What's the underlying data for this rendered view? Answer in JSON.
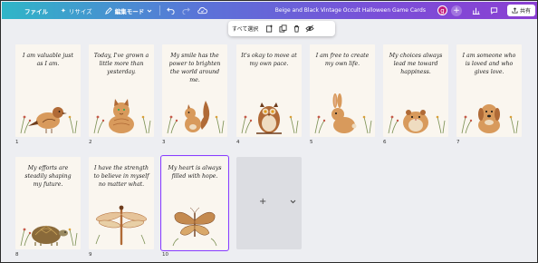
{
  "toolbar": {
    "file_label": "ファイル",
    "resize_label": "リサイズ",
    "mode_label": "編集モード",
    "doc_title": "Beige and Black Vintage Occult Halloween Game Cards",
    "avatar_letter": "g",
    "share_label": "共有"
  },
  "selection_toolbar": {
    "select_all_label": "すべて選択"
  },
  "pages": [
    {
      "number": "1",
      "quote": "I am valuable just as I am.",
      "animal": "bird"
    },
    {
      "number": "2",
      "quote": "Today, I've grown a little more than yesterday.",
      "animal": "cat"
    },
    {
      "number": "3",
      "quote": "My smile has the power to brighten the world around me.",
      "animal": "squirrel"
    },
    {
      "number": "4",
      "quote": "It's okay to move at my own pace.",
      "animal": "owl"
    },
    {
      "number": "5",
      "quote": "I am free to create my own life.",
      "animal": "rabbit"
    },
    {
      "number": "6",
      "quote": "My choices always lead me toward happiness.",
      "animal": "hamster"
    },
    {
      "number": "7",
      "quote": "I am someone who is loved and who gives love.",
      "animal": "dog"
    },
    {
      "number": "8",
      "quote": "My efforts are steadily shaping my future.",
      "animal": "turtle"
    },
    {
      "number": "9",
      "quote": "I have the strength to believe in myself no matter what.",
      "animal": "dragonfly"
    },
    {
      "number": "10",
      "quote": "My heart is always filled with hope.",
      "animal": "butterfly"
    }
  ],
  "add_page": {
    "plus": "+"
  },
  "colors": {
    "toolbar_gradient_start": "#2fb6c7",
    "toolbar_gradient_end": "#8b3fd2",
    "selection_outline": "#8b3dff",
    "card_bg": "#faf6ef",
    "canvas_bg": "#edeef2"
  }
}
